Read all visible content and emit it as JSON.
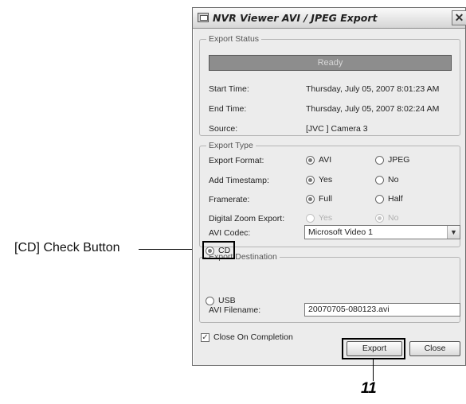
{
  "window": {
    "title": "NVR Viewer AVI / JPEG Export",
    "close_glyph": "✕"
  },
  "export_status": {
    "legend": "Export Status",
    "status_text": "Ready",
    "start_label": "Start Time:",
    "start_value": "Thursday, July 05, 2007 8:01:23 AM",
    "end_label": "End Time:",
    "end_value": "Thursday, July 05, 2007 8:02:24 AM",
    "source_label": "Source:",
    "source_value": "[JVC ] Camera 3"
  },
  "export_type": {
    "legend": "Export Type",
    "format_label": "Export Format:",
    "format_options": [
      "AVI",
      "JPEG"
    ],
    "format_selected": "AVI",
    "timestamp_label": "Add Timestamp:",
    "timestamp_options": [
      "Yes",
      "No"
    ],
    "timestamp_selected": "Yes",
    "framerate_label": "Framerate:",
    "framerate_options": [
      "Full",
      "Half"
    ],
    "framerate_selected": "Full",
    "zoom_label": "Digital Zoom Export:",
    "zoom_options": [
      "Yes",
      "No"
    ],
    "zoom_selected": "No",
    "codec_label": "AVI Codec:",
    "codec_value": "Microsoft Video 1"
  },
  "export_destination": {
    "legend": "Export Destination",
    "cd_label": "CD",
    "usb_label": "USB",
    "selected": "CD",
    "filename_label": "AVI Filename:",
    "filename_value": "20070705-080123.avi"
  },
  "footer": {
    "close_on_completion_label": "Close On Completion",
    "close_on_completion_checked": true,
    "export_button": "Export",
    "close_button": "Close"
  },
  "annotations": {
    "cd_callout": "[CD] Check Button",
    "step_number": "11"
  },
  "icons": [
    "app-icon",
    "close-icon",
    "chevron-down-icon",
    "check-icon"
  ],
  "colors": {
    "status_bar": "#8d8d8d",
    "window_bg": "#ececec"
  }
}
